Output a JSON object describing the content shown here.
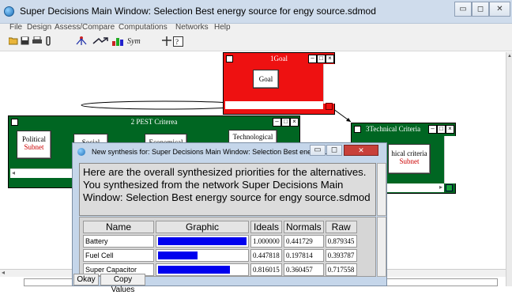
{
  "window": {
    "title": "Super Decisions Main Window: Selection Best energy source for engy source.sdmod",
    "minimize": "▭",
    "maximize": "◻",
    "close": "✕"
  },
  "menu": [
    "File",
    "Design",
    "Assess/Compare",
    "Computations",
    "Networks",
    "Help"
  ],
  "toolbar": {
    "sym_label": "Sym"
  },
  "nodes": {
    "goal": {
      "title": "1Goal",
      "button": "Goal",
      "color": "#ee1111"
    },
    "pest": {
      "title": "2 PEST Criterea",
      "color": "#006622",
      "items": [
        {
          "line1": "Political",
          "line2": "Subnet"
        },
        {
          "line1": "Social",
          "line2": ""
        },
        {
          "line1": "Economical",
          "line2": ""
        },
        {
          "line1": "Technological",
          "line2": ""
        }
      ]
    },
    "technical": {
      "title": "3Technical Criteria",
      "color": "#006622",
      "button_line1": "hical criteria",
      "button_line2": "Subnet"
    }
  },
  "dialog": {
    "title": "New synthesis for: Super Decisions Main Window: Selection Best energy...",
    "message": "Here are the overall synthesized priorities for the alternatives. You synthesized from the network Super Decisions Main Window: Selection Best energy source for engy source.sdmod",
    "columns": [
      "Name",
      "Graphic",
      "Ideals",
      "Normals",
      "Raw"
    ],
    "rows": [
      {
        "name": "Battery",
        "ideal": "1.000000",
        "normal": "0.441729",
        "raw": "0.879345",
        "bar": 1.0
      },
      {
        "name": "Fuel Cell",
        "ideal": "0.447818",
        "normal": "0.197814",
        "raw": "0.393787",
        "bar": 0.447818
      },
      {
        "name": "Super Capacitor",
        "ideal": "0.816015",
        "normal": "0.360457",
        "raw": "0.717558",
        "bar": 0.816015
      }
    ],
    "okay": "Okay",
    "copy": "Copy Values"
  }
}
